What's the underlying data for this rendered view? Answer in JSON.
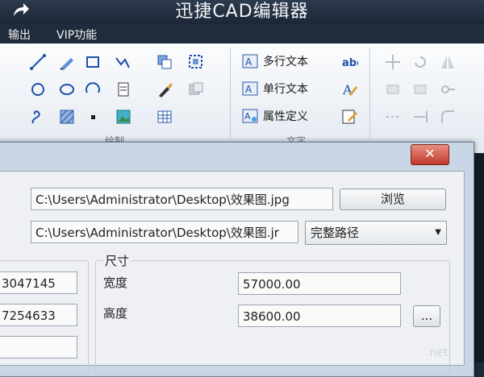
{
  "app": {
    "title": "迅捷CAD编辑器"
  },
  "menu": {
    "items": [
      "输出",
      "VIP功能"
    ]
  },
  "ribbon": {
    "text_tools": [
      "多行文本",
      "单行文本",
      "属性定义"
    ],
    "group_labels": [
      "绘制",
      "文字"
    ]
  },
  "dialog": {
    "path_value": "C:\\Users\\Administrator\\Desktop\\效果图.jpg",
    "path_value2": "C:\\Users\\Administrator\\Desktop\\效果图.jr",
    "browse_label": "浏览",
    "path_mode": "完整路径",
    "left_values": [
      "3047145",
      "7254633",
      ""
    ],
    "size": {
      "title": "尺寸",
      "width_label": "宽度",
      "width_value": "57000.00",
      "height_label": "高度",
      "height_value": "38600.00",
      "more_label": "..."
    },
    "close_label": "✕"
  },
  "watermark": ".net"
}
